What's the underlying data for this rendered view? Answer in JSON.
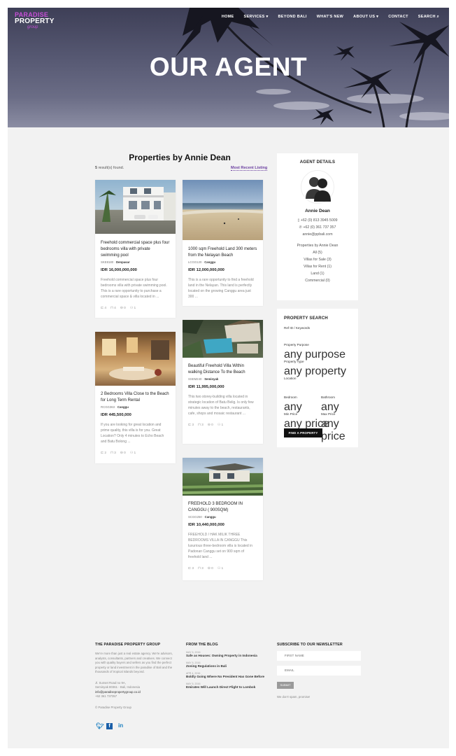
{
  "header": {
    "logo": {
      "line1": "PARADISE",
      "line2": "PROPERTY",
      "line3": "group"
    },
    "nav": [
      "HOME",
      "SERVICES ▾",
      "BEYOND BALI",
      "WHAT'S NEW",
      "ABOUT US ▾",
      "CONTACT",
      "SEARCH ⌕"
    ],
    "hero_title": "OUR AGENT"
  },
  "listing": {
    "title": "Properties by Annie Dean",
    "results_count": "5",
    "results_suffix": " result(s) found.",
    "sort_label": "Most Recent Listing"
  },
  "properties": [
    {
      "title": "Freehold commercial space plus four bedrooms villa with private swimming pool",
      "code": "SKE8180 ·",
      "location": "Denpasar",
      "price": "IDR 16,000,000,000",
      "desc": "Freehold commercial space plus four bedrooms villa with private swimming pool. This is a rare opportunity to purchase a commercial space & villa located in ...",
      "beds": "4",
      "baths": "4",
      "cars": "0",
      "people": "1"
    },
    {
      "title": "1000 sqm Freehold Land 300 meters from the Nelayan Beach",
      "code": "LCGG120 ·",
      "location": "Canggu",
      "price": "IDR 12,000,000,000",
      "desc": "This is a rare opportunity to find a freehold land in the Nelayan. This land is perfectly located on the growing Canggu area just 300 ...",
      "beds": "",
      "baths": "",
      "cars": "",
      "people": ""
    },
    {
      "title": "2 Bedrooms Villa Close to the Beach for Long Term Rental",
      "code": "RCGG363 ·",
      "location": "Canggu",
      "price": "IDR 445,500,000",
      "desc": "If you are looking for great location and prime quality, this villa is for you. Great Location? Only 4 minutes to Echo Beach and Batu Bolong ...",
      "beds": "2",
      "baths": "3",
      "cars": "0",
      "people": "1"
    },
    {
      "title": "Beautiful Freehold Villa Within walking Distance To the Beach",
      "code": "SSEM240 ·",
      "location": "Seminyak",
      "price": "IDR 11,995,000,000",
      "desc": "This two storey-building villa located in strategic location of Batu Belig. Is only few minutes away to the beach, restaurants, cafe, shops and mosaic restaurant ...",
      "beds": "3",
      "baths": "3",
      "cars": "0",
      "people": "1"
    },
    {
      "title": "FREEHOLD 3 BEDROOM IN CANGGU ( 900SQM)",
      "code": "SCGG250 ·",
      "location": "Canggu",
      "price": "IDR 10,440,000,000",
      "desc": "FREEHOLD / HAK MILIK THREE BEDROOMS VILLA IN CANGGU This luxurious three-bedroom villa is located in Padonan Canggu set on 900 sqm of freehold land ...",
      "beds": "3",
      "baths": "3",
      "cars": "0",
      "people": "1"
    }
  ],
  "agent": {
    "title": "AGENT DETAILS",
    "name": "Annie Dean",
    "phone1": "+62 (0) 813 3945 5009",
    "phone2": "+62 (0) 361 737 357",
    "email": "annie@ppbali.com",
    "props_heading": "Properties by Annie Dean",
    "counts": [
      "All (5)",
      "Villas for Sale (3)",
      "Villas for Rent (1)",
      "Land (1)",
      "Commercial (0)"
    ]
  },
  "search": {
    "title": "PROPERTY SEARCH",
    "ref_label": "Ref ID / Keywords",
    "ref_value": "",
    "purpose_label": "Property Purpose",
    "purpose_value": "any purpose",
    "type_label": "Property Type",
    "type_value": "any property",
    "location_label": "Location",
    "location_value": "",
    "bedroom_label": "Bedroom",
    "bedroom_value": "any",
    "bathroom_label": "Bathroom",
    "bathroom_value": "any",
    "minprice_label": "Min Price",
    "minprice_value": "any price",
    "maxprice_label": "Max Price",
    "maxprice_value": "any price",
    "button": "FIND A PROPERTY"
  },
  "footer": {
    "about_title": "THE PARADISE PROPERTY GROUP",
    "about_text": "We're more than just a real estate agency. We're advisors, analysts, consultants, partners and creatives. We connect you with quality buyers and sellers as you find the perfect property or land investment in the paradise of Bali and the thousands of tropical islands beyond.",
    "address1": "Jl. Sunset Road no 9A,",
    "address2": "Seminyak 80361 - Bali, Indonesia",
    "email": "info@paradisepropertygroup.co.id",
    "phone": "+62 361 737357",
    "copyright": "© Paradise Property Group",
    "blog_title": "FROM THE BLOG",
    "blog": [
      {
        "date": "MAY 5, 2016",
        "title": "Safe as Houses: Owning Property in Indonesia"
      },
      {
        "date": "MAY 5, 2016",
        "title": "Zoning Regulations in Bali"
      },
      {
        "date": "APR 4, 2016",
        "title": "Boldly Going Where No President Has Gone Before"
      },
      {
        "date": "MAY 5, 2016",
        "title": "Emirates Will Launch Direct Flight to Lombok"
      }
    ],
    "newsletter_title": "SUBSCRIBE TO OUR NEWSLETTER",
    "first_name_placeholder": "FIRST NAME",
    "email_placeholder": "EMAIL",
    "submit": "SUBMIT",
    "spam_note": "We don't spam, promise!"
  },
  "colors": {
    "brand_purple": "#6b3fa0",
    "logo_pink": "#c64fd6",
    "social_blue": "#1b7fc0"
  }
}
